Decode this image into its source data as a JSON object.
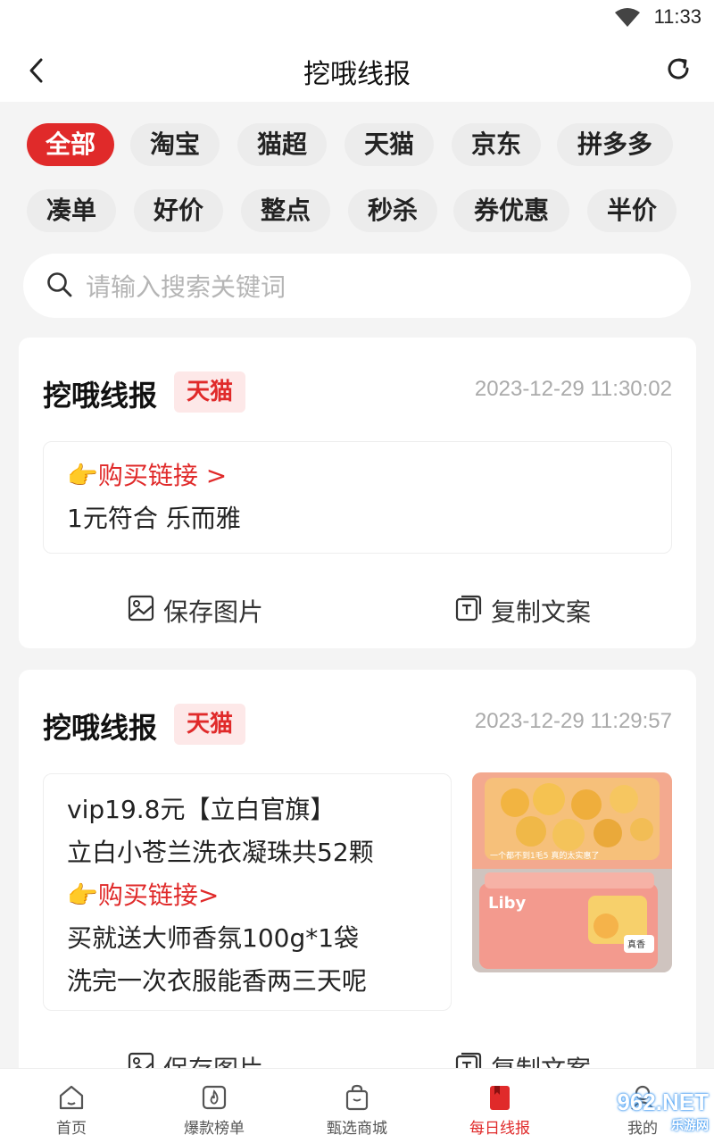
{
  "status": {
    "time": "11:33"
  },
  "header": {
    "title": "挖哦线报"
  },
  "filters": {
    "row1": [
      "全部",
      "淘宝",
      "猫超",
      "天猫",
      "京东",
      "拼多多"
    ],
    "row2": [
      "凑单",
      "好价",
      "整点",
      "秒杀",
      "券优惠",
      "半价"
    ],
    "active": "全部"
  },
  "search": {
    "placeholder": "请输入搜索关键词"
  },
  "posts": [
    {
      "title": "挖哦线报",
      "platform": "天猫",
      "time": "2023-12-29 11:30:02",
      "link_label": "👉购买链接 >",
      "lines": [
        "1元符合 乐而雅"
      ],
      "save_label": "保存图片",
      "copy_label": "复制文案"
    },
    {
      "title": "挖哦线报",
      "platform": "天猫",
      "time": "2023-12-29 11:29:57",
      "line1": "vip19.8元【立白官旗】",
      "line2": "立白小苍兰洗衣凝珠共52颗",
      "link_label": "👉购买链接>",
      "line4": "买就送大师香氛100g*1袋",
      "line5": "洗完一次衣服能香两三天呢",
      "image_caption": "一个都不到1毛5 真的太实惠了",
      "image_brand": "Liby",
      "image_tag": "真香",
      "save_label": "保存图片",
      "copy_label": "复制文案"
    }
  ],
  "tabbar": {
    "items": [
      "首页",
      "爆款榜单",
      "甄选商城",
      "每日线报",
      "我的"
    ],
    "active": "每日线报"
  },
  "watermark": {
    "main": "962.NET",
    "sub": "乐游网"
  },
  "colors": {
    "accent": "#e02a2a",
    "background": "#f4f4f4"
  }
}
